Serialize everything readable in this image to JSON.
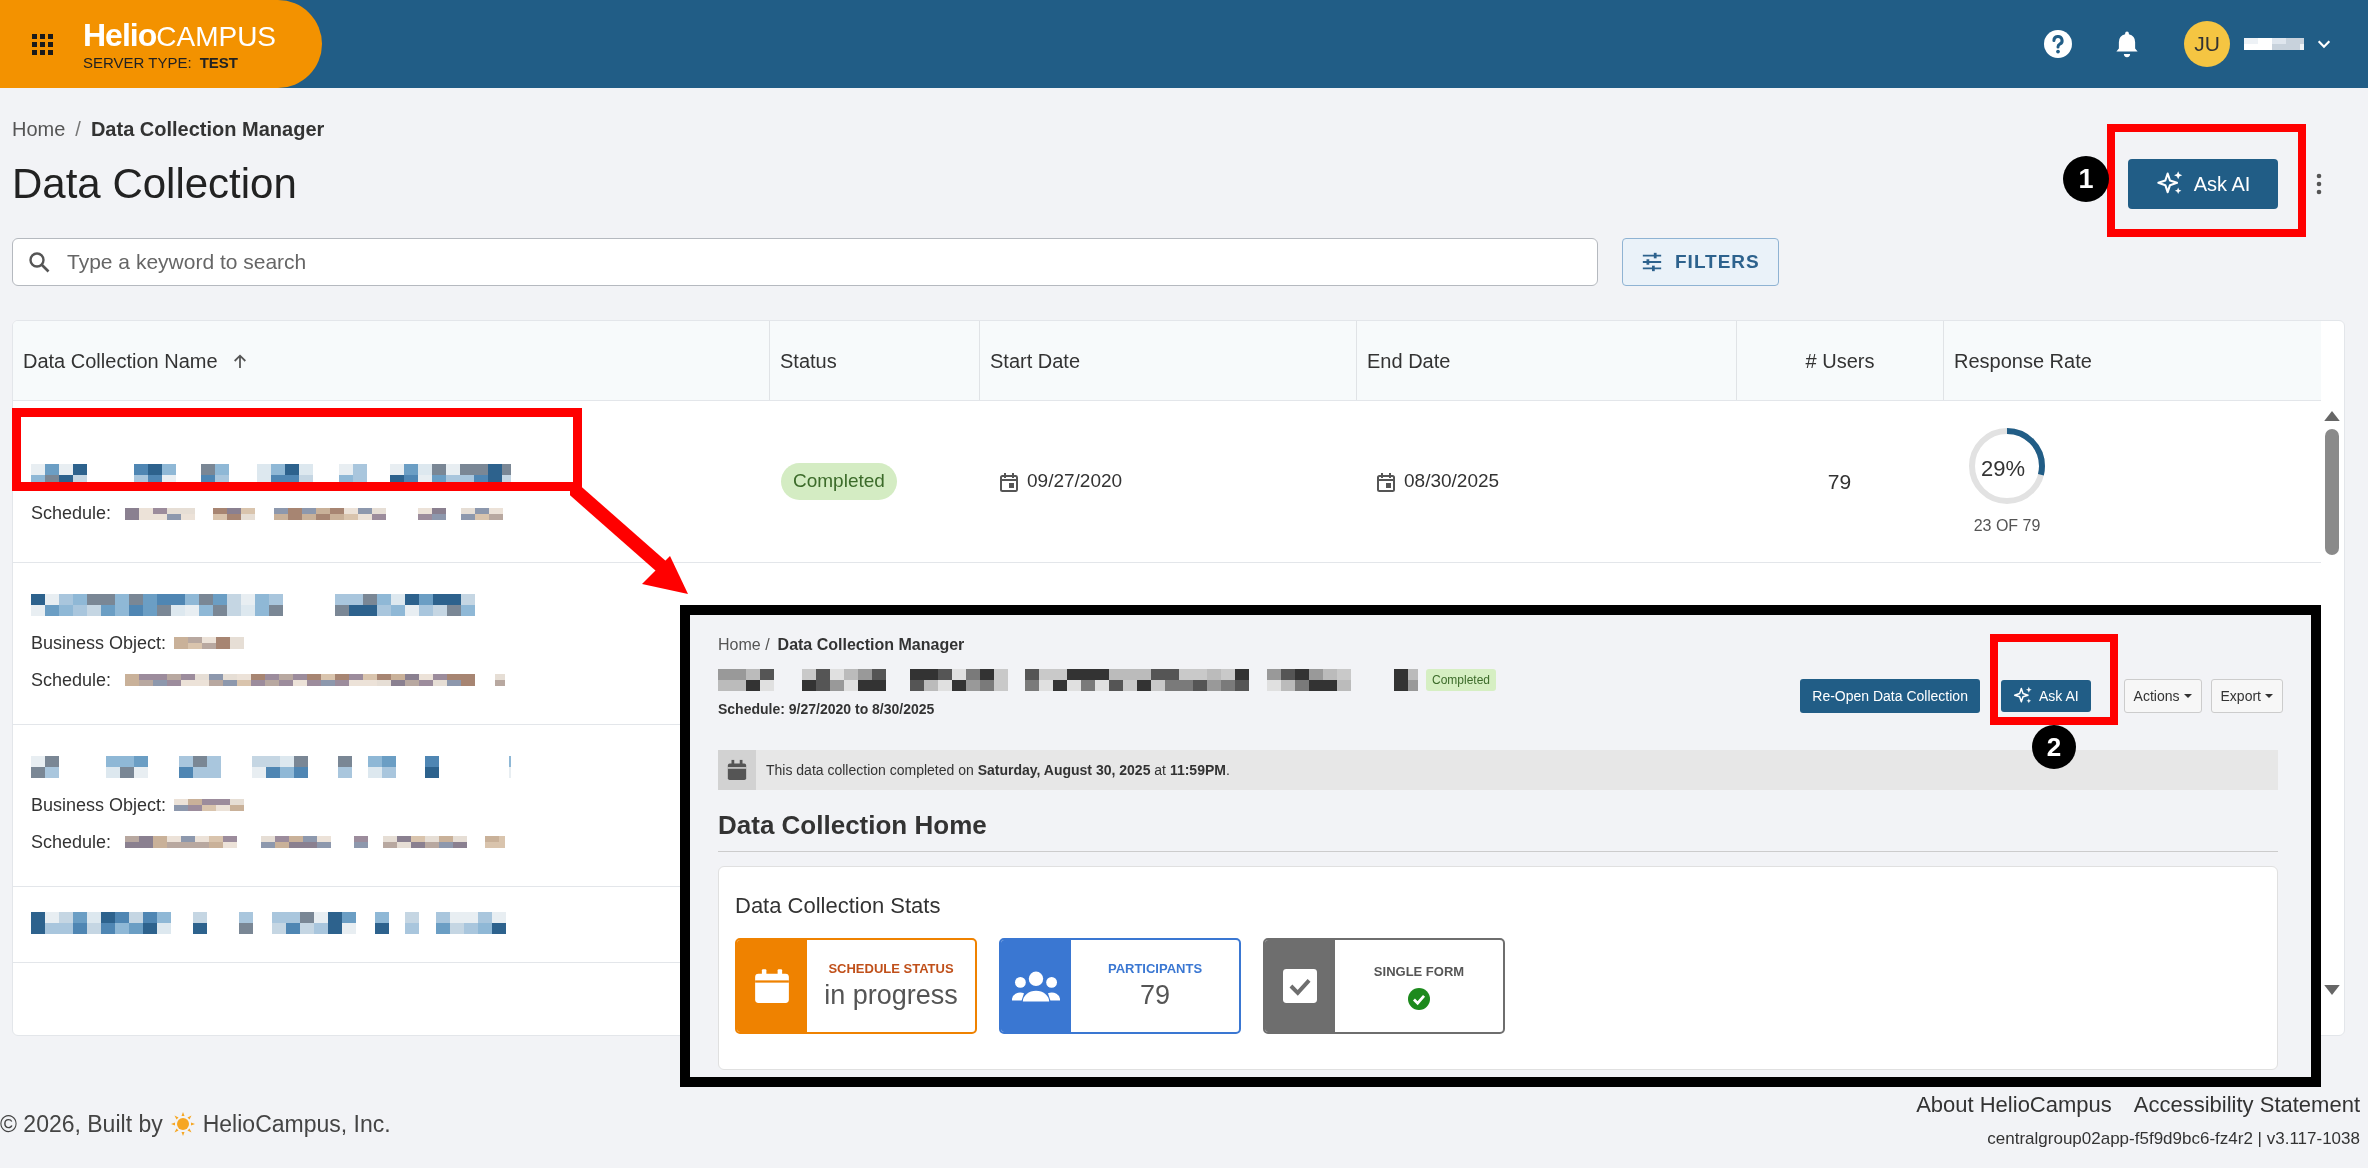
{
  "header": {
    "logo_word": "Helio",
    "logo_word_2": "CAMPUS",
    "server_type_label": "SERVER TYPE:",
    "server_type": "TEST",
    "user_initials": "JU"
  },
  "breadcrumb": [
    {
      "label": "Home"
    },
    {
      "label": "Data Collection Manager"
    }
  ],
  "breadcrumb_separator": "/",
  "title": "Data Collection",
  "ask_ai": {
    "label": "Ask AI",
    "callout": "1"
  },
  "search": {
    "placeholder": "Type a keyword to search"
  },
  "filters_button": "FILTERS",
  "table": {
    "columns": [
      {
        "label": "Data Collection Name",
        "sorted": true
      },
      {
        "label": "Status",
        "sorted": false
      },
      {
        "label": "Start Date",
        "sorted": false
      },
      {
        "label": "End Date",
        "sorted": false
      },
      {
        "label": "# Users",
        "sorted": false
      },
      {
        "label": "Response Rate",
        "sorted": false
      }
    ],
    "rows": [
      {
        "kind": "full",
        "schedule_label": "Schedule:",
        "status": "Completed",
        "start_date": "09/27/2020",
        "end_date": "08/30/2025",
        "users": "79",
        "response": {
          "percent": "29%",
          "level": 0.29,
          "count": "23 OF 79"
        }
      },
      {
        "kind": "partial",
        "business_object_label": "Business Object:",
        "schedule_label": "Schedule:"
      },
      {
        "kind": "partial",
        "business_object_label": "Business Object:",
        "schedule_label": "Schedule:"
      },
      {
        "kind": "name_only"
      }
    ]
  },
  "inset": {
    "breadcrumb": [
      {
        "label": "Home /"
      },
      {
        "label": "Data Collection Manager"
      }
    ],
    "status": "Completed",
    "schedule": "Schedule: 9/27/2020 to 8/30/2025",
    "buttons": [
      {
        "kind": "primary",
        "label": "Re-Open Data Collection"
      },
      {
        "kind": "ai",
        "label": "Ask AI"
      },
      {
        "kind": "dropdown",
        "label": "Actions"
      },
      {
        "kind": "dropdown",
        "label": "Export"
      }
    ],
    "callout": "2",
    "notice": "This data collection completed on **Saturday, August 30, 2025** at **11:59PM**.",
    "heading": "Data Collection Home",
    "stats_title": "Data Collection Stats",
    "stats": [
      {
        "kind": "calendar",
        "color": "#ef8200",
        "label": "SCHEDULE STATUS",
        "value": "in progress"
      },
      {
        "kind": "people",
        "color": "#3a77d2",
        "label": "PARTICIPANTS",
        "value": "79"
      },
      {
        "kind": "form",
        "color": "#6e6e6e",
        "label": "SINGLE FORM",
        "completed": true
      }
    ]
  },
  "footer": {
    "copyright": "© 2026, Built by",
    "company": "HelioCampus, Inc.",
    "links": [
      "About HelioCampus",
      "Accessibility Statement"
    ],
    "version": "centralgroup02app-f5f9d9bc6-fz4r2 | v3.117-1038"
  }
}
